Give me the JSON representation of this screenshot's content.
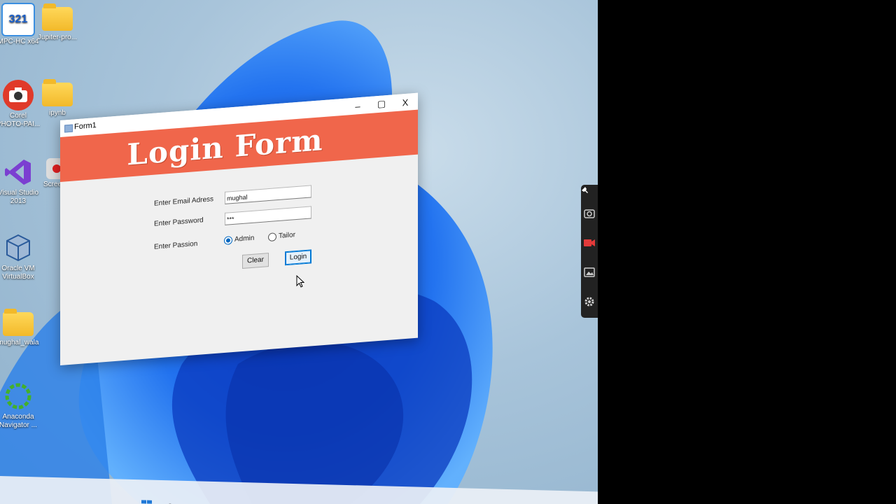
{
  "desktop_icons": [
    {
      "label": "MPC-HC x64",
      "id": "mpc"
    },
    {
      "label": "Jupiter-pro...",
      "id": "jupiter"
    },
    {
      "label": "Corel PHOTO-PAI...",
      "id": "corel"
    },
    {
      "label": "ipynb",
      "id": "ipynb"
    },
    {
      "label": "Visual Studio 2013",
      "id": "vs"
    },
    {
      "label": "Screen...",
      "id": "screen"
    },
    {
      "label": "Oracle VM VirtualBox",
      "id": "vbox"
    },
    {
      "label": "mughal_wala",
      "id": "mughal"
    },
    {
      "label": "Anaconda Navigator ...",
      "id": "anaconda"
    }
  ],
  "window": {
    "title": "Form1",
    "minimize": "–",
    "maximize": "▢",
    "close": "X",
    "header_title": "Login Form"
  },
  "form": {
    "email_label": "Enter Email Adress",
    "email_value": "mughal",
    "password_label": "Enter Password",
    "password_value": "***",
    "passion_label": "Enter Passion",
    "option_admin": "Admin",
    "option_tailor": "Tailor",
    "selected_option": "Admin",
    "clear_button": "Clear",
    "login_button": "Login"
  },
  "mpc_glyph": "321",
  "colors": {
    "header": "#f0664b",
    "accent": "#0067c0"
  }
}
